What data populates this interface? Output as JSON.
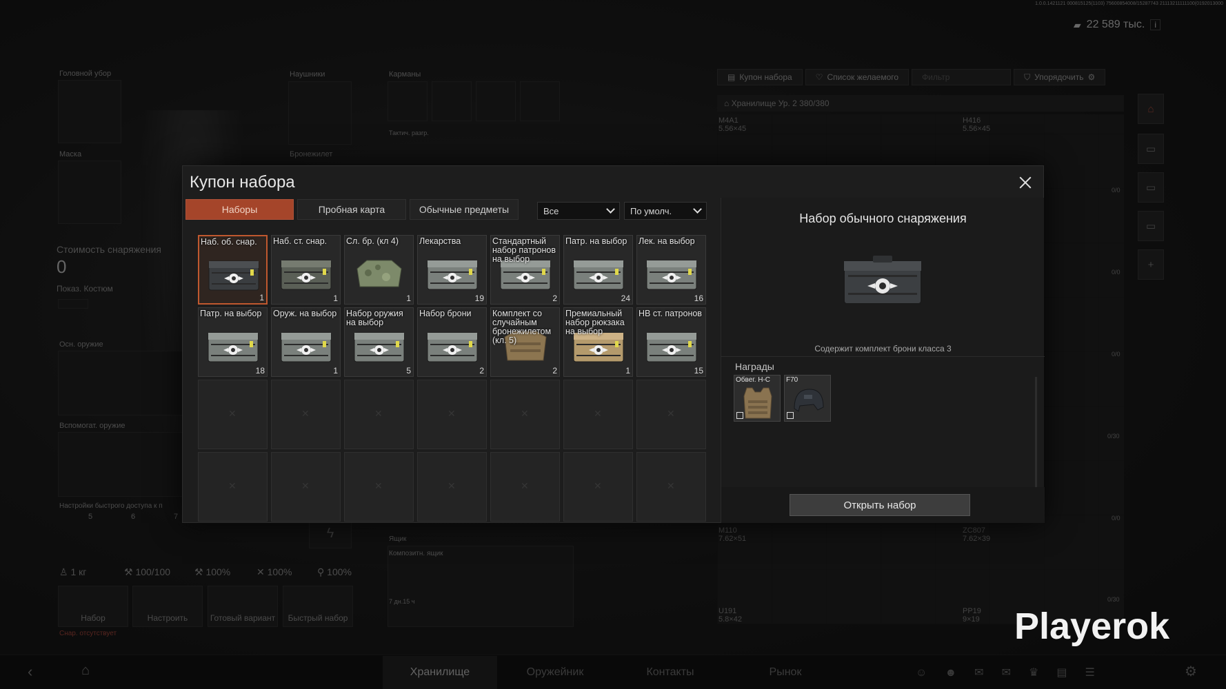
{
  "version_text": "1.0.0.1421121 000815125(1103) 75600854008/15287743 21113211111100(0192013000",
  "money": "22 589 тыс.",
  "background": {
    "equipment_labels": {
      "headwear": "Головной убор",
      "headphones": "Наушники",
      "pockets": "Карманы",
      "tactical": "Тактич. разгр.",
      "mask": "Маска",
      "armor": "Бронежилет",
      "cost": "Стоимость снаряжения",
      "cost_value": "0",
      "show_costume": "Показ. Костюм",
      "primary": "Осн. оружие",
      "secondary": "Вспомогат. оружие",
      "quick": "Настройки быстрого доступа к п",
      "box": "Ящик",
      "composite_box": "Композитн. ящик",
      "box_time": "7 дн.15 ч"
    },
    "top_buttons": [
      "Купон набора",
      "Список желаемого",
      "Фильтр",
      "Упорядочить"
    ],
    "storage_header": "Хранилище Ур. 2 380/380",
    "weapons": [
      {
        "name": "M4A1",
        "caliber": "5.56×45"
      },
      {
        "name": "H416",
        "caliber": "5.56×45"
      },
      {
        "name": "M110",
        "caliber": "7.62×51"
      },
      {
        "name": "ZC807",
        "caliber": "7.62×39"
      },
      {
        "name": "U191",
        "caliber": "5.8×42"
      },
      {
        "name": "PP19",
        "caliber": "9×19"
      }
    ],
    "stats": {
      "weight": "1 кг",
      "s1": "100/100",
      "s2": "100%",
      "s3": "100%",
      "s4": "100%"
    },
    "quick_buttons": [
      "Набор",
      "Настроить",
      "Готовый вариант",
      "Быстрый набор"
    ],
    "missing_note": "Снар. отсутствует",
    "bottom_tabs": [
      "Хранилище",
      "Оружейник",
      "Контакты",
      "Рынок"
    ],
    "slot_nums": [
      "5",
      "6",
      "7"
    ],
    "counts": [
      "0/0",
      "0/0",
      "0/0",
      "0/30",
      "0/0",
      "0/30"
    ]
  },
  "dialog": {
    "title": "Купон набора",
    "tabs": [
      "Наборы",
      "Пробная карта",
      "Обычные предметы"
    ],
    "active_tab": 0,
    "filter": "Все",
    "sort": "По умолч.",
    "items": [
      {
        "label": "Наб. об. снар.",
        "count": "1",
        "img": "dark-case",
        "selected": true
      },
      {
        "label": "Наб. ст. снар.",
        "count": "1",
        "img": "camo-case"
      },
      {
        "label": "Сл. бр. (кл 4)",
        "count": "1",
        "img": "armor-camo"
      },
      {
        "label": "Лекарства",
        "count": "19",
        "img": "gray-case"
      },
      {
        "label": "Стандартный набор патронов на выбор",
        "count": "2",
        "img": "gray-case"
      },
      {
        "label": "Патр. на выбор",
        "count": "24",
        "img": "gray-case"
      },
      {
        "label": "Лек. на выбор",
        "count": "16",
        "img": "gray-case"
      },
      {
        "label": "Патр. на выбор",
        "count": "18",
        "img": "gray-case"
      },
      {
        "label": "Оруж. на выбор",
        "count": "1",
        "img": "gray-case"
      },
      {
        "label": "Набор оружия на выбор",
        "count": "5",
        "img": "gray-case"
      },
      {
        "label": "Набор брони",
        "count": "2",
        "img": "gray-case"
      },
      {
        "label": "Комплект со случайным бронежилетом (кл. 5)",
        "count": "2",
        "img": "armor-tan"
      },
      {
        "label": "Премиальный набор рюкзака на выбор",
        "count": "1",
        "img": "tan-case"
      },
      {
        "label": "НВ ст. патронов",
        "count": "15",
        "img": "gray-case"
      }
    ],
    "detail": {
      "title": "Набор обычного снаряжения",
      "description": "Содержит комплект брони класса 3",
      "rewards_header": "Награды",
      "rewards": [
        {
          "label": "Обвег. H-C",
          "icon": "vest-icon"
        },
        {
          "label": "F70",
          "icon": "helmet-icon"
        }
      ],
      "open_button": "Открыть набор"
    }
  },
  "watermark": "Playerok",
  "colors": {
    "accent": "#a5452a",
    "selected_border": "#c0582f"
  }
}
